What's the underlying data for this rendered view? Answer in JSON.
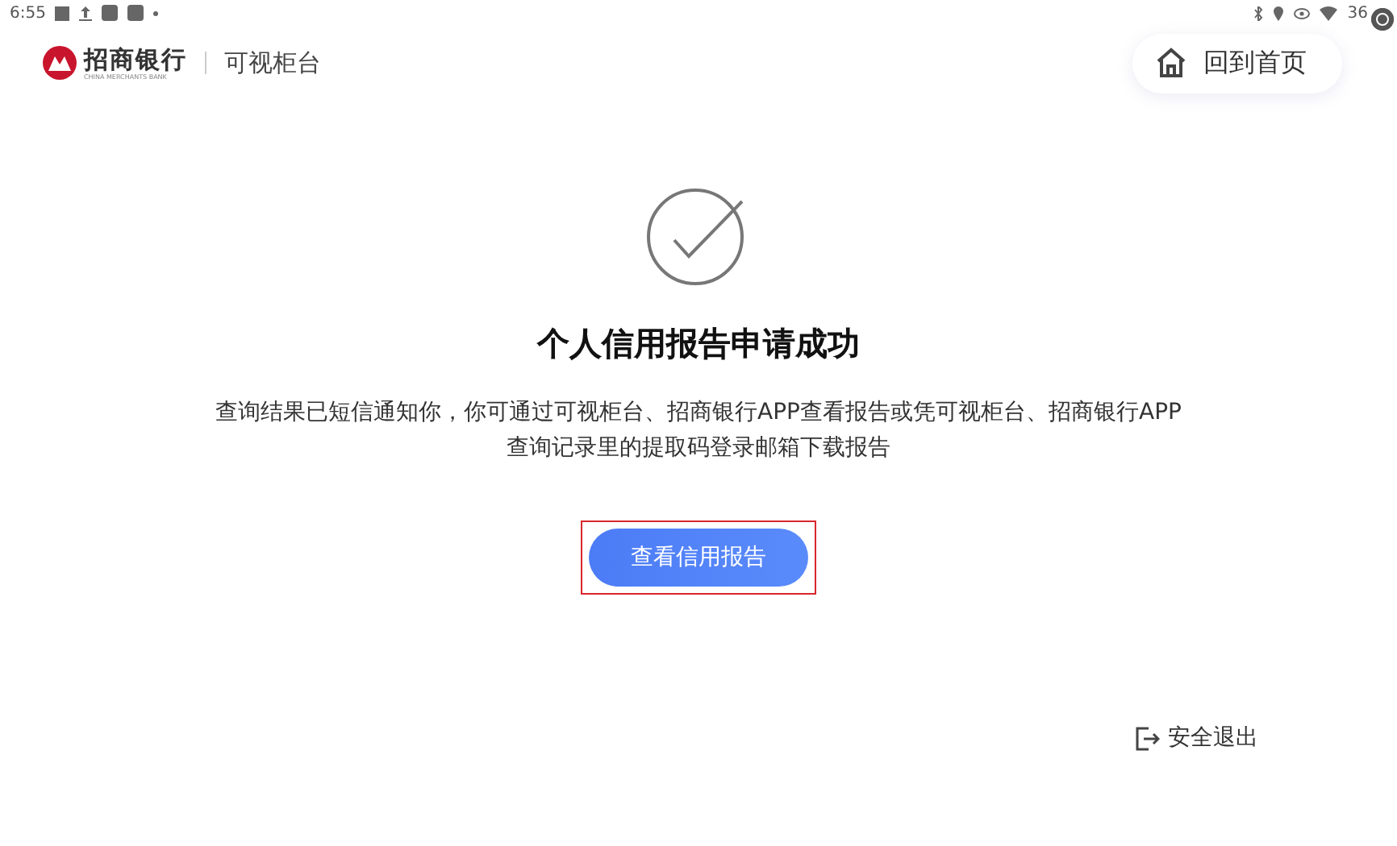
{
  "status_bar": {
    "time": "6:55",
    "battery": "36"
  },
  "header": {
    "bank_name": "招商银行",
    "bank_name_en": "CHINA MERCHANTS BANK",
    "service": "可视柜台",
    "home_button": "回到首页"
  },
  "result": {
    "title": "个人信用报告申请成功",
    "message": "查询结果已短信通知你，你可通过可视柜台、招商银行APP查看报告或凭可视柜台、招商银行APP查询记录里的提取码登录邮箱下载报告",
    "button": "查看信用报告",
    "highlighted": true
  },
  "footer": {
    "exit": "安全退出"
  }
}
